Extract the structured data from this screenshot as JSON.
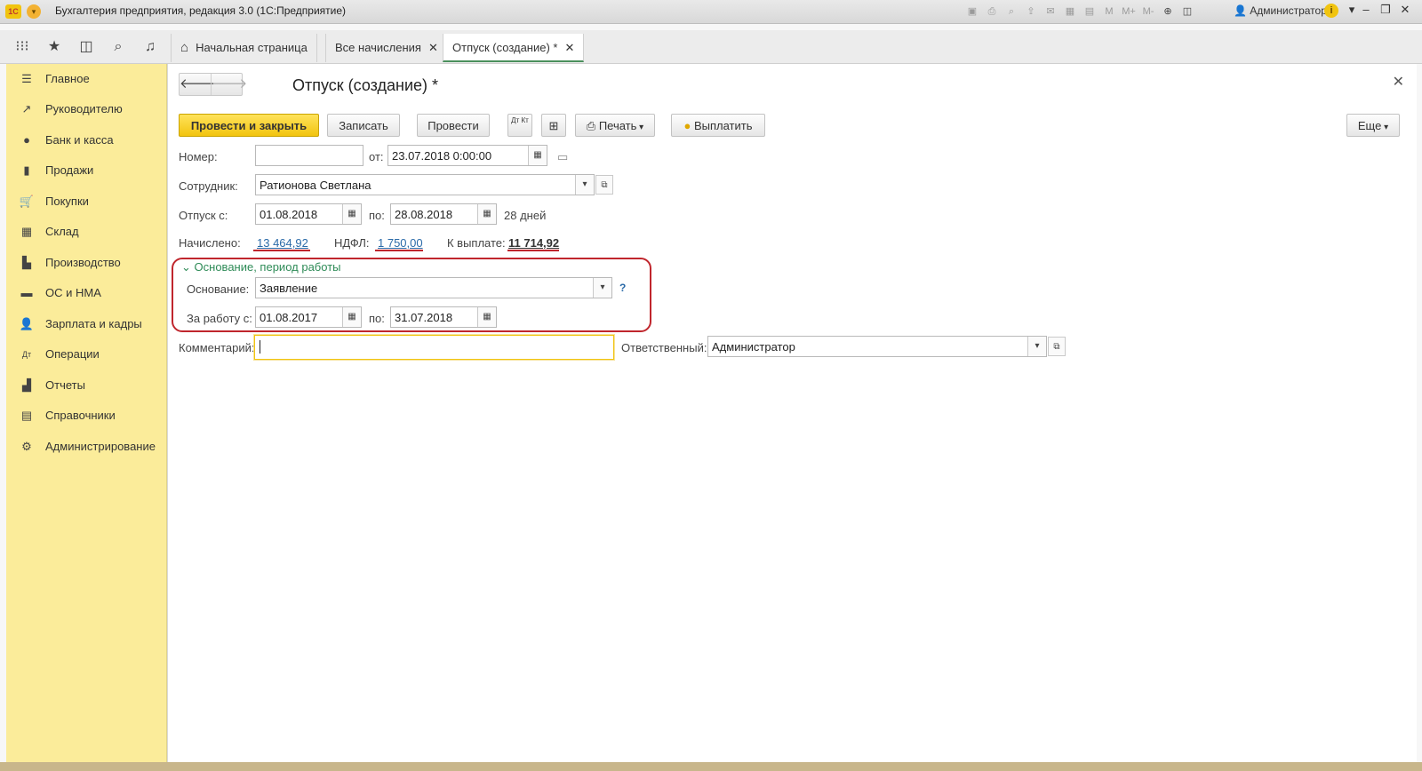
{
  "titlebar": {
    "app_logo": "1С",
    "title": "Бухгалтерия предприятия, редакция 3.0  (1С:Предприятие)",
    "m_buttons": [
      "M",
      "M+",
      "M-"
    ],
    "user": "Администратор",
    "info": "i"
  },
  "tabs": [
    {
      "label": "Начальная страница"
    },
    {
      "label": "Все начисления"
    },
    {
      "label": "Отпуск (создание) *"
    }
  ],
  "sidebar": {
    "items": [
      {
        "label": "Главное"
      },
      {
        "label": "Руководителю"
      },
      {
        "label": "Банк и касса"
      },
      {
        "label": "Продажи"
      },
      {
        "label": "Покупки"
      },
      {
        "label": "Склад"
      },
      {
        "label": "Производство"
      },
      {
        "label": "ОС и НМА"
      },
      {
        "label": "Зарплата и кадры"
      },
      {
        "label": "Операции"
      },
      {
        "label": "Отчеты"
      },
      {
        "label": "Справочники"
      },
      {
        "label": "Администрирование"
      }
    ]
  },
  "document": {
    "title": "Отпуск (создание) *",
    "toolbar": {
      "post_close": "Провести и закрыть",
      "save": "Записать",
      "post": "Провести",
      "print": "Печать",
      "pay": "Выплатить",
      "more": "Еще",
      "dtkt": "Дт Кт"
    },
    "number_label": "Номер:",
    "number_value": "",
    "from_label": "от:",
    "date_value": "23.07.2018  0:00:00",
    "employee_label": "Сотрудник:",
    "employee_value": "Ратионова Светлана",
    "vac_from_label": "Отпуск с:",
    "vac_from": "01.08.2018",
    "vac_to_label": "по:",
    "vac_to": "28.08.2018",
    "vac_days": "28 дней",
    "accrued_label": "Начислено:",
    "accrued": "13 464,92",
    "ndfl_label": "НДФЛ:",
    "ndfl": "1 750,00",
    "pay_label": "К выплате:",
    "pay": "11 714,92",
    "group_title": "Основание, период работы",
    "basis_label": "Основание:",
    "basis_value": "Заявление",
    "help": "?",
    "work_from_label": "За работу с:",
    "work_from": "01.08.2017",
    "work_to_label": "по:",
    "work_to": "31.07.2018",
    "comment_label": "Комментарий:",
    "comment_value": "",
    "responsible_label": "Ответственный:",
    "responsible_value": "Администратор"
  },
  "colors": {
    "sidebar_bg": "#fbec9a",
    "primary_button": "#f2c40f",
    "highlight_red": "#c0262d",
    "group_title": "#2e8b57",
    "link": "#2a6aa8"
  }
}
